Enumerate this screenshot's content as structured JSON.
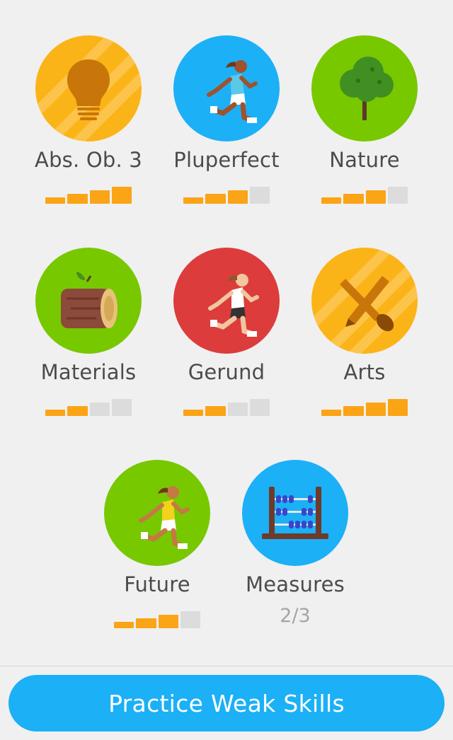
{
  "colors": {
    "gold": "#fbb418",
    "blue": "#1cb0f6",
    "green": "#78c800",
    "red": "#dc3c3c",
    "bar_on": "#fba416",
    "bar_off": "#dcdcdc",
    "button": "#1cb0f6"
  },
  "skills": [
    {
      "name": "Abs. Ob. 3",
      "icon": "lightbulb-icon",
      "color": "#fbb418",
      "level": 4,
      "max_level": 4
    },
    {
      "name": "Pluperfect",
      "icon": "runner-icon",
      "color": "#1cb0f6",
      "level": 3,
      "max_level": 4
    },
    {
      "name": "Nature",
      "icon": "tree-icon",
      "color": "#78c800",
      "level": 3,
      "max_level": 4
    },
    {
      "name": "Materials",
      "icon": "log-icon",
      "color": "#78c800",
      "level": 2,
      "max_level": 4
    },
    {
      "name": "Gerund",
      "icon": "runner-icon",
      "color": "#dc3c3c",
      "level": 2,
      "max_level": 4
    },
    {
      "name": "Arts",
      "icon": "pencil-brush-icon",
      "color": "#fbb418",
      "level": 4,
      "max_level": 4
    },
    {
      "name": "Future",
      "icon": "runner-icon",
      "color": "#78c800",
      "level": 3,
      "max_level": 4
    },
    {
      "name": "Measures",
      "icon": "abacus-icon",
      "color": "#1cb0f6",
      "progress_text": "2/3",
      "progress": 0.6667
    }
  ],
  "footer": {
    "practice_label": "Practice Weak Skills"
  }
}
